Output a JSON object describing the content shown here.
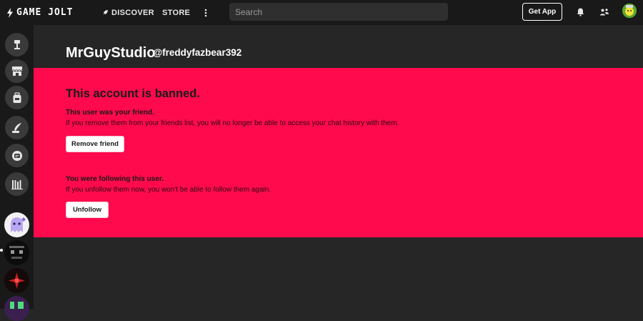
{
  "topbar": {
    "logo_text": "GAME JOLT",
    "nav": {
      "discover": "DISCOVER",
      "store": "STORE",
      "more": "⋮"
    },
    "search": {
      "placeholder": "Search",
      "value": ""
    },
    "get_app": "Get App"
  },
  "sidebar": {
    "items": [
      {
        "name": "home",
        "icon": "home-lamp-icon"
      },
      {
        "name": "store",
        "icon": "store-icon"
      },
      {
        "name": "inventory",
        "icon": "backpack-icon"
      },
      {
        "name": "realms",
        "icon": "quill-icon"
      },
      {
        "name": "chat",
        "icon": "chat-icon"
      },
      {
        "name": "library",
        "icon": "library-icon"
      }
    ],
    "communities": [
      {
        "name": "community-ghost"
      },
      {
        "name": "community-dark"
      },
      {
        "name": "community-red"
      },
      {
        "name": "community-partial"
      }
    ]
  },
  "profile": {
    "display_name": "MrGuyStudio",
    "username": "@freddyfazbear392"
  },
  "ban": {
    "title": "This account is banned.",
    "friend_title": "This user was your friend.",
    "friend_text": "If you remove them from your friends list, you will no longer be able to access your chat history with them.",
    "remove_friend": "Remove friend",
    "follow_title": "You were following this user.",
    "follow_text": "If you unfollow them now, you won't be able to follow them again.",
    "unfollow": "Unfollow"
  },
  "colors": {
    "ban_panel": "#ff0a4d",
    "topbar": "#191919",
    "background": "#262626"
  }
}
